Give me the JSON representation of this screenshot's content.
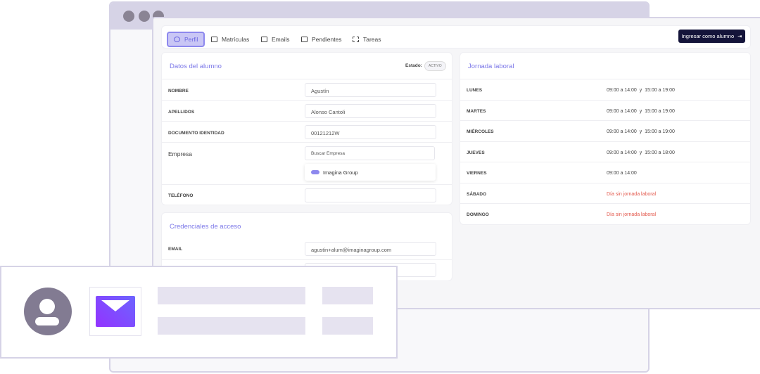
{
  "tabs": [
    {
      "label": "Perfil",
      "icon": "user-circle-icon"
    },
    {
      "label": "Matrículas",
      "icon": "folder-icon"
    },
    {
      "label": "Emails",
      "icon": "mail-icon"
    },
    {
      "label": "Pendientes",
      "icon": "inbox-icon"
    },
    {
      "label": "Tareas",
      "icon": "tasks-icon"
    }
  ],
  "login_button": "Ingresar como alumno",
  "student": {
    "title": "Datos del alumno",
    "status_label": "Estado:",
    "status": "ACTIVO",
    "fields": {
      "nombre_label": "NOMBRE",
      "nombre": "Agustín",
      "apellidos_label": "APELLIDOS",
      "apellidos": "Alonso Cantoli",
      "doc_label": "DOCUMENTO IDENTIDAD",
      "doc": "00121212W",
      "empresa_label": "Empresa",
      "empresa_placeholder": "Buscar Empresa",
      "empresa_option": "Imagina Group",
      "telefono_label": "TELÉFONO",
      "telefono": ""
    }
  },
  "credentials": {
    "title": "Credenciales de acceso",
    "email_label": "EMAIL",
    "email": "agustin+alum@imaginagroup.com"
  },
  "schedule": {
    "title": "Jornada laboral",
    "days": [
      {
        "day": "LUNES",
        "hours": "09:00 a 14:00  y  15:00 a 19:00",
        "off": false
      },
      {
        "day": "MARTES",
        "hours": "09:00 a 14:00  y  15:00 a 19:00",
        "off": false
      },
      {
        "day": "MIÉRCOLES",
        "hours": "09:00 a 14:00  y  15:00 a 19:00",
        "off": false
      },
      {
        "day": "JUEVES",
        "hours": "09:00 a 14:00  y  15:00 a 18:00",
        "off": false
      },
      {
        "day": "VIERNES",
        "hours": "09:00 a 14:00",
        "off": false
      },
      {
        "day": "SÁBADO",
        "hours": "Día sin jornada laboral",
        "off": true
      },
      {
        "day": "DOMINGO",
        "hours": "Día sin jornada laboral",
        "off": true
      }
    ]
  },
  "colors": {
    "accent": "#7c78e8",
    "dark": "#14143a",
    "off": "#e3574b"
  }
}
